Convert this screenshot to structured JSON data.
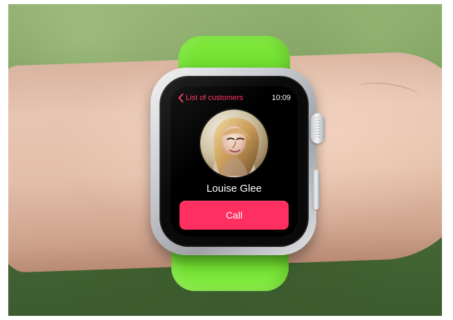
{
  "colors": {
    "accent": "#ff2f61",
    "band": "#7be23d"
  },
  "watch": {
    "status_bar": {
      "back_icon": "chevron-left-icon",
      "back_label": "List of customers",
      "time": "10:09"
    },
    "contact": {
      "name": "Louise Glee",
      "avatar_icon": "portrait-avatar"
    },
    "actions": {
      "call_label": "Call"
    }
  }
}
